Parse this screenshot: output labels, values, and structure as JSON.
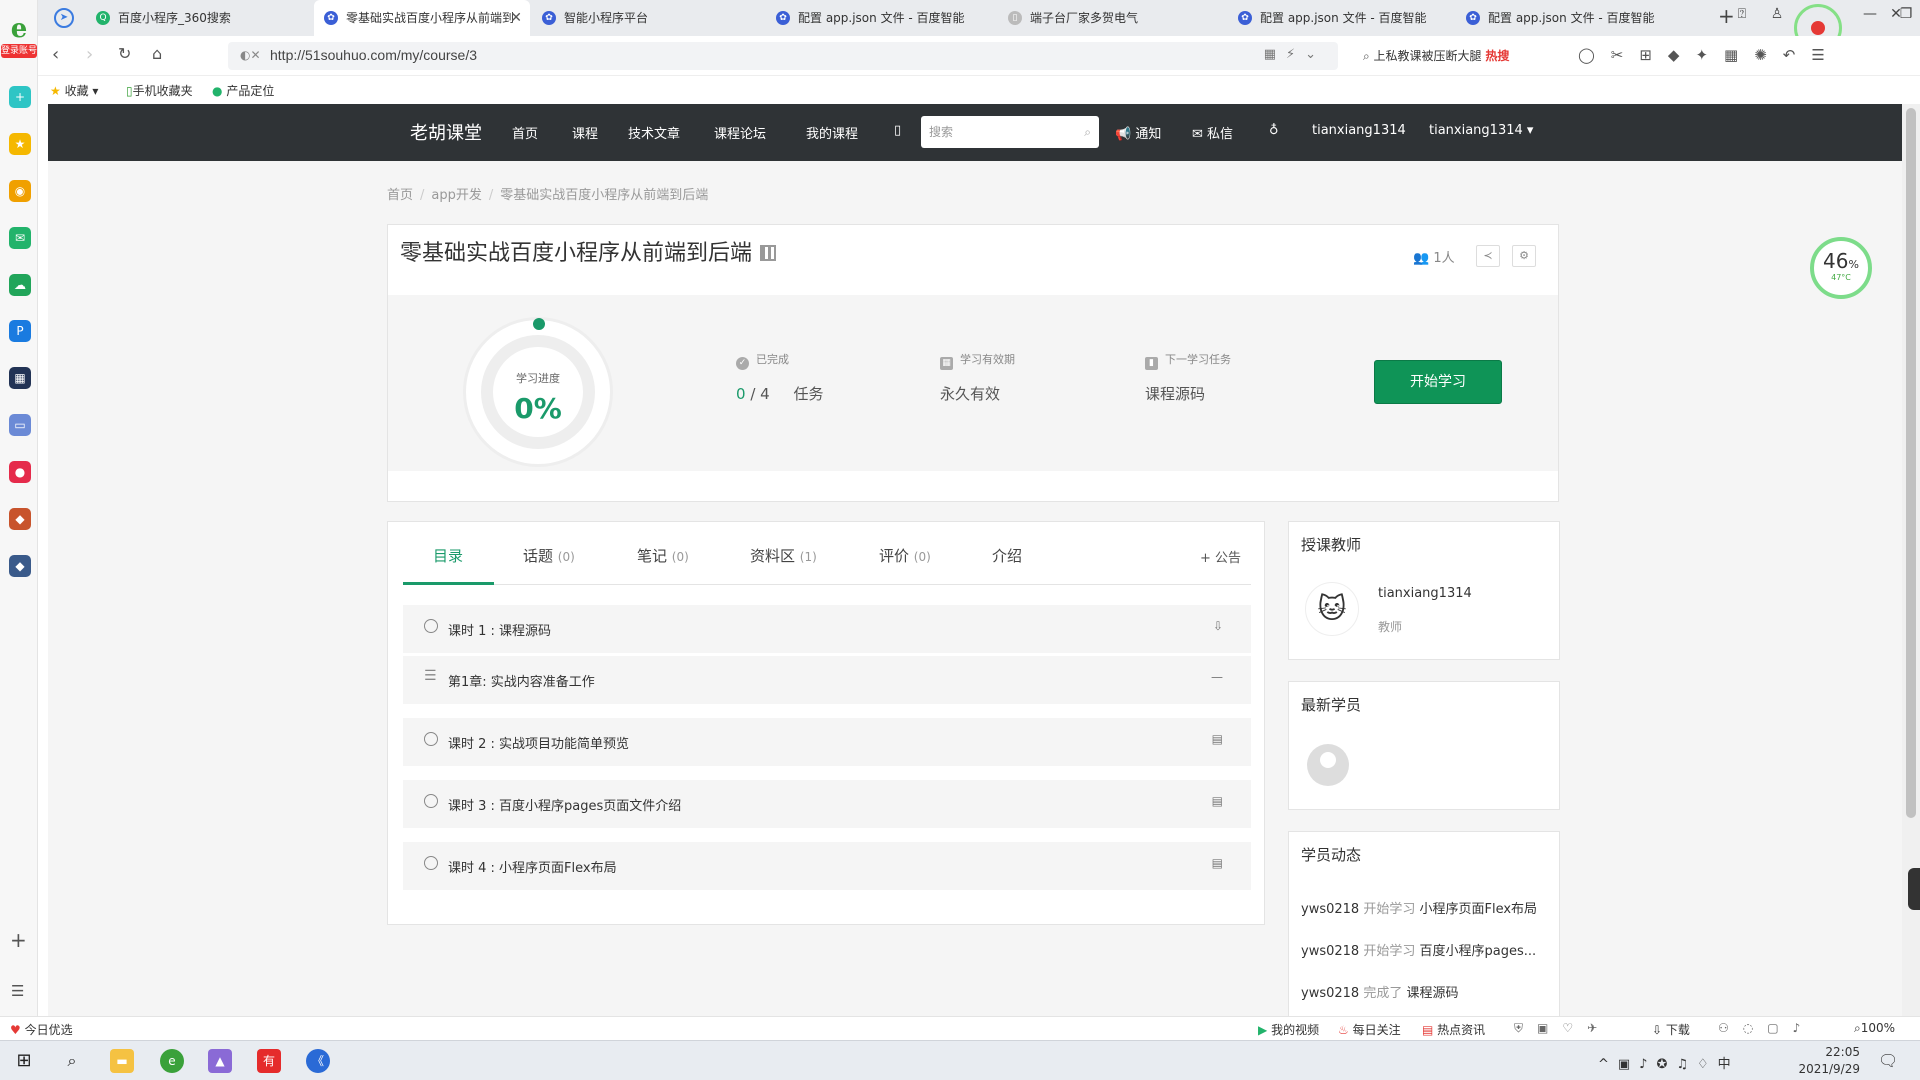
{
  "browser": {
    "rail_badge": "登录账号",
    "tabs": [
      {
        "label": "百度小程序_360搜索",
        "active": false
      },
      {
        "label": "零基础实战百度小程序从前端到",
        "active": true
      },
      {
        "label": "智能小程序平台",
        "active": false
      },
      {
        "label": "配置 app.json 文件 - 百度智能",
        "active": false
      },
      {
        "label": "端子台厂家多贺电气",
        "active": false
      },
      {
        "label": "配置 app.json 文件 - 百度智能",
        "active": false
      },
      {
        "label": "配置 app.json 文件 - 百度智能",
        "active": false
      }
    ],
    "url": "http://51souhuo.com/my/course/3",
    "search_hint": "上私教课被压断大腿",
    "hot_tag": "热搜",
    "bookmarks": [
      "收藏",
      "手机收藏夹",
      "产品定位"
    ]
  },
  "site": {
    "brand": "老胡课堂",
    "nav": [
      "首页",
      "课程",
      "技术文章",
      "课程论坛",
      "我的课程"
    ],
    "search_placeholder": "搜索",
    "notify": "通知",
    "message": "私信",
    "user1": "tianxiang1314",
    "user2": "tianxiang1314"
  },
  "breadcrumb": [
    "首页",
    "app开发",
    "零基础实战百度小程序从前端到后端"
  ],
  "course": {
    "title": "零基础实战百度小程序从前端到后端",
    "members": "1人",
    "progress_label": "学习进度",
    "progress_pct": "0%",
    "progress_fraction": 0,
    "done_head": "已完成",
    "done_val": "0",
    "done_total": "4",
    "done_unit": "任务",
    "valid_head": "学习有效期",
    "valid_val": "永久有效",
    "next_head": "下一学习任务",
    "next_val": "课程源码",
    "start_button": "开始学习"
  },
  "tabs": {
    "items": [
      {
        "label": "目录",
        "count": ""
      },
      {
        "label": "话题",
        "count": "(0)"
      },
      {
        "label": "笔记",
        "count": "(0)"
      },
      {
        "label": "资料区",
        "count": "(1)"
      },
      {
        "label": "评价",
        "count": "(0)"
      },
      {
        "label": "介绍",
        "count": ""
      }
    ],
    "notice": "+ 公告"
  },
  "lessons": [
    {
      "text": "课时 1 : 课程源码",
      "type": "lesson",
      "right": "⇩"
    },
    {
      "text": "第1章: 实战内容准备工作",
      "type": "chapter",
      "right": "—"
    },
    {
      "text": "课时 2 : 实战项目功能简单预览",
      "type": "lesson",
      "right": "▤"
    },
    {
      "text": "课时 3 : 百度小程序pages页面文件介绍",
      "type": "lesson",
      "right": "▤"
    },
    {
      "text": "课时 4 : 小程序页面Flex布局",
      "type": "lesson",
      "right": "▤"
    }
  ],
  "sidebar": {
    "teacher_title": "授课教师",
    "teacher_name": "tianxiang1314",
    "teacher_role": "教师",
    "students_title": "最新学员",
    "activity_title": "学员动态",
    "activities": [
      {
        "user": "yws0218",
        "action": "开始学习",
        "target": "小程序页面Flex布局"
      },
      {
        "user": "yws0218",
        "action": "开始学习",
        "target": "百度小程序pages..."
      },
      {
        "user": "yws0218",
        "action": "完成了",
        "target": "课程源码"
      }
    ]
  },
  "cpu_widget": {
    "pct": "46",
    "unit": "%",
    "temp": "47°C"
  },
  "statusbar": {
    "left": "今日优选",
    "items": [
      "我的视频",
      "每日关注",
      "热点资讯",
      "下载",
      "100%"
    ]
  },
  "taskbar": {
    "time": "22:05",
    "date": "2021/9/29"
  },
  "colors": {
    "accent": "#1a9a6a",
    "nav_bg": "#2f3336",
    "start_btn": "#0f9457"
  }
}
